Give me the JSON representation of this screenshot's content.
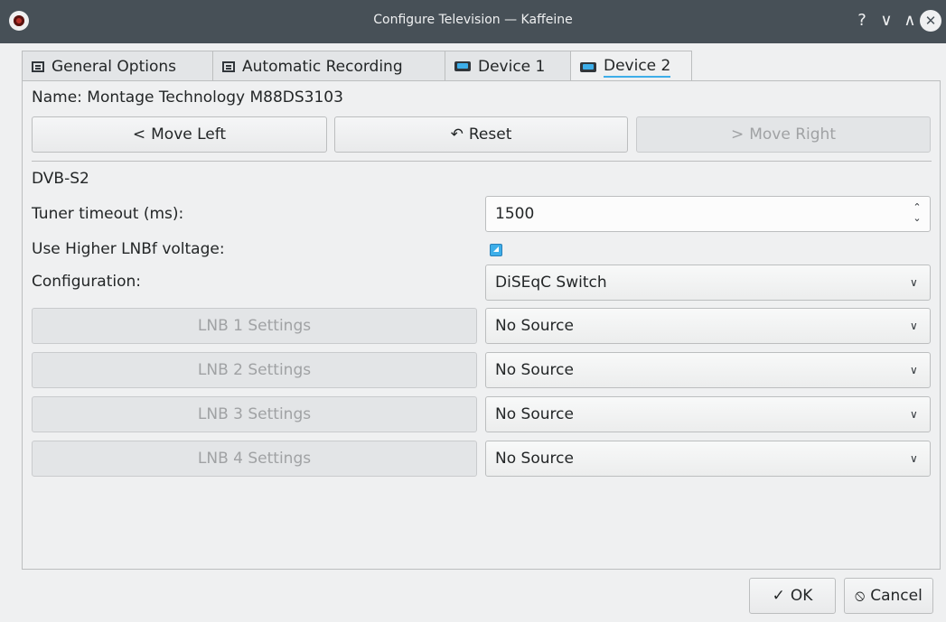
{
  "window": {
    "title": "Configure Television — Kaffeine",
    "help_glyph": "?",
    "minimize_glyph": "∨",
    "maximize_glyph": "∧",
    "close_glyph": "✕"
  },
  "tabs": [
    {
      "label": "General Options",
      "icon": "document-icon"
    },
    {
      "label": "Automatic Recording",
      "icon": "document-icon"
    },
    {
      "label": "Device 1",
      "icon": "tv-icon"
    },
    {
      "label": "Device 2",
      "icon": "tv-icon",
      "active": true
    }
  ],
  "device": {
    "name_label": "Name: Montage Technology M88DS3103",
    "move_left": "Move Left",
    "move_left_glyph": "<",
    "reset": "Reset",
    "reset_glyph": "↶",
    "move_right": "Move Right",
    "move_right_glyph": ">",
    "section": "DVB-S2",
    "tuner_timeout_label": "Tuner timeout (ms):",
    "tuner_timeout_value": "1500",
    "higher_lnbf_label": "Use Higher LNBf voltage:",
    "higher_lnbf_checked": true,
    "configuration_label": "Configuration:",
    "configuration_value": "DiSEqC Switch",
    "lnbs": [
      {
        "button": "LNB 1 Settings",
        "source": "No Source"
      },
      {
        "button": "LNB 2 Settings",
        "source": "No Source"
      },
      {
        "button": "LNB 3 Settings",
        "source": "No Source"
      },
      {
        "button": "LNB 4 Settings",
        "source": "No Source"
      }
    ]
  },
  "footer": {
    "ok": "OK",
    "ok_glyph": "✓",
    "cancel": "Cancel",
    "cancel_glyph": "⦸"
  },
  "colors": {
    "titlebar": "#475057",
    "accent": "#3daee9",
    "background": "#eff0f1"
  }
}
